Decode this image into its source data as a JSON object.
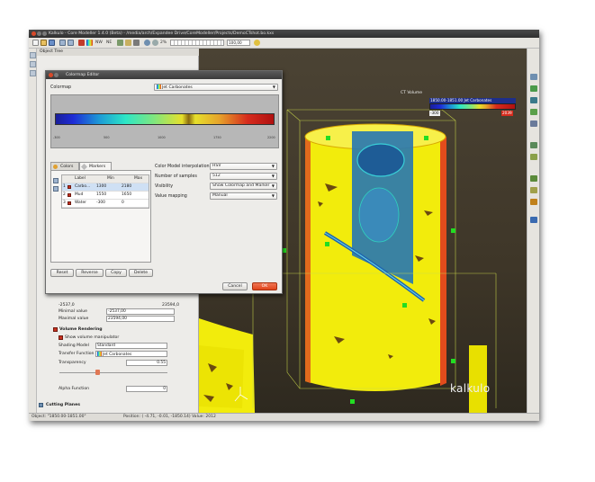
{
  "window": {
    "title": "Kalkulo - Core Modeller 1.4.0 (Beta) - /media/arch/Expandee Drive/CoreModeller/Projects/DemoCTshot.bo.kxs"
  },
  "toolbar": {
    "zoom_percent": "2%",
    "field_value": "100,00",
    "labels": [
      "NW",
      "NE"
    ]
  },
  "object_tree": {
    "title": "Object Tree"
  },
  "dialog": {
    "title": "Colormap Editor",
    "colormap_label": "Colormap",
    "colormap_value": "Jet Carbonates",
    "preview_ticks": [
      "-300",
      "500",
      "1000",
      "1750",
      "2200"
    ],
    "tabs": [
      "Colors",
      "Markers"
    ],
    "table": {
      "headers": [
        "Label",
        "Min",
        "Max"
      ],
      "rows": [
        {
          "num": "1",
          "label": "Carbo...",
          "min": "1300",
          "max": "2180"
        },
        {
          "num": "2",
          "label": "Mud",
          "min": "1550",
          "max": "1650"
        },
        {
          "num": "3",
          "label": "Water",
          "min": "-300",
          "max": "0"
        }
      ]
    },
    "settings": [
      {
        "label": "Color Model interpolation",
        "value": "HSV"
      },
      {
        "label": "Number of samples",
        "value": "512"
      },
      {
        "label": "Visibility",
        "value": "Show Colormap and Marker"
      },
      {
        "label": "Value mapping",
        "value": "Manual"
      }
    ],
    "buttons": {
      "reset": "Reset",
      "reverse": "Reverse",
      "copy": "Copy",
      "delete": "Delete",
      "cancel": "Cancel",
      "ok": "OK"
    }
  },
  "properties": {
    "range_min": "-2537,0",
    "range_max": "23594,0",
    "minimal_label": "Minimal value",
    "minimal_value": "-2537,00",
    "maximal_label": "Maximal value",
    "maximal_value": "23594,00",
    "volume_rendering": "Volume Rendering",
    "show_manipulator": "Show volume manipulator",
    "shading_label": "Shading Model",
    "shading_value": "Standard",
    "transfer_label": "Transfer Function",
    "transfer_value": "Jet Carbonates",
    "transparency_label": "Transparency",
    "transparency_value": "0.55",
    "alpha_label": "Alpha Function",
    "alpha_value": "0",
    "cutting_planes": "Cutting Planes"
  },
  "viewport": {
    "legend_title": "CT Volume",
    "legend_header": "1850.00-1851.00 Jet Carbonates",
    "legend_min": "-300",
    "legend_max": "2039",
    "brand": "kalkulo"
  },
  "status": {
    "object": "Object: \"1850.00-1851.00\"",
    "position": "Position: ( -4.71,  -0.01, -1850.14)  Value: 2012"
  },
  "colors": {
    "accent": "#e0441c",
    "core_yellow": "#f2ec0c",
    "core_blue": "#2a78b0",
    "frame_green": "#22dd22"
  }
}
